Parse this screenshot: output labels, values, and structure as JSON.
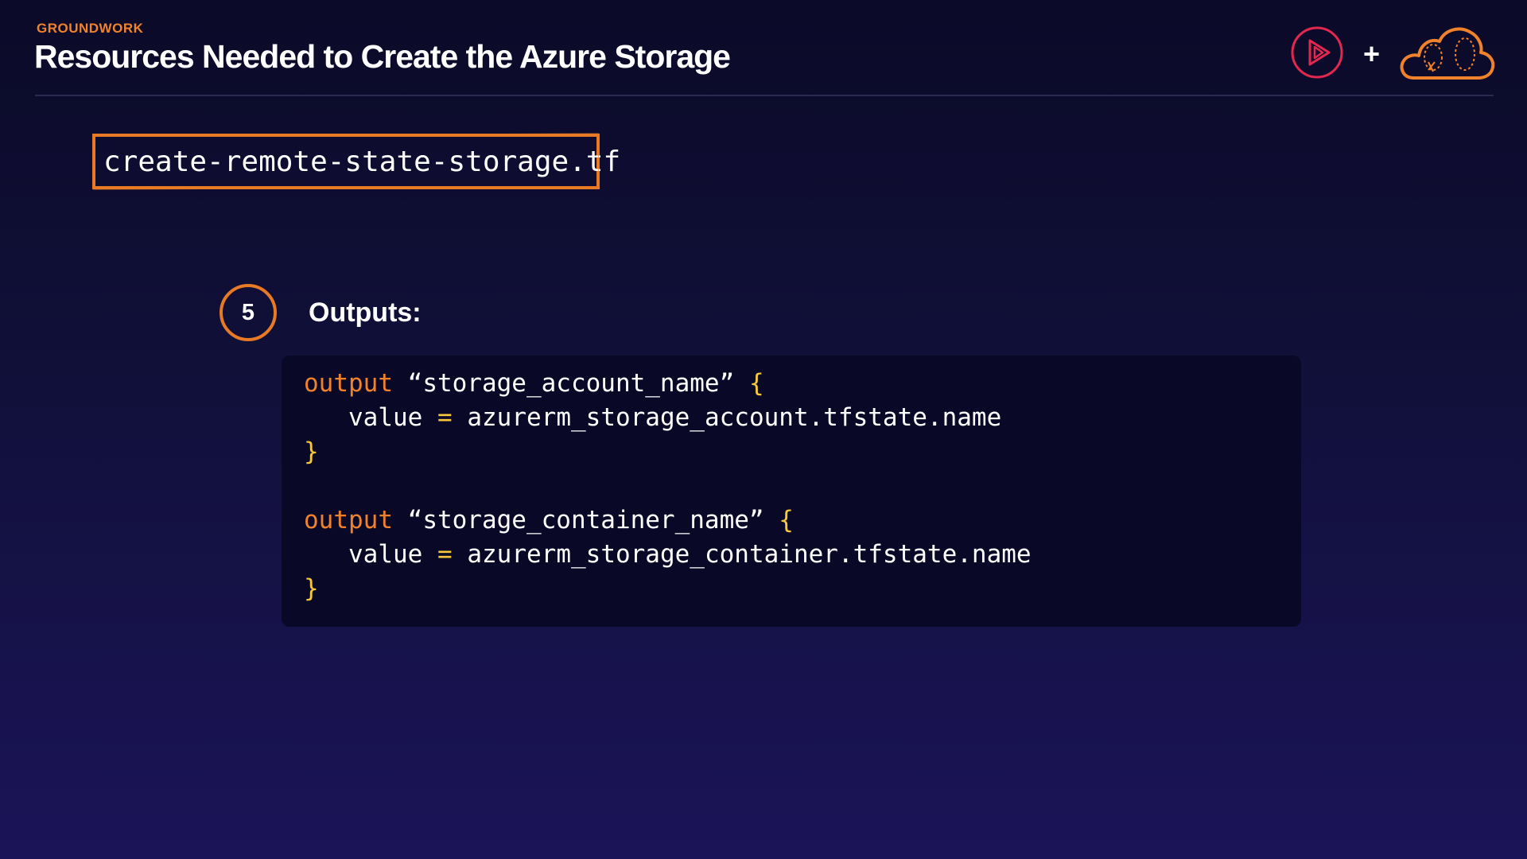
{
  "header": {
    "eyebrow": "GROUNDWORK",
    "title": "Resources Needed to Create the Azure Storage",
    "plus": "+"
  },
  "icons": {
    "play_logo": "play-circle-icon",
    "cloud_logo": "cloud-icon"
  },
  "filename": "create-remote-state-storage.tf",
  "step": {
    "number": "5",
    "label": "Outputs:"
  },
  "code": {
    "blocks": [
      {
        "keyword": "output",
        "name": "“storage_account_name”",
        "open_brace": "{",
        "attr": "value",
        "op": "=",
        "expr": "azurerm_storage_account.tfstate.name",
        "close_brace": "}"
      },
      {
        "keyword": "output",
        "name": "“storage_container_name”",
        "open_brace": "{",
        "attr": "value",
        "op": "=",
        "expr": "azurerm_storage_container.tfstate.name",
        "close_brace": "}"
      }
    ]
  },
  "colors": {
    "accent_orange": "#e87a25",
    "brace_yellow": "#f7c93a",
    "code_bg": "#090827",
    "play_logo": "#e3284f"
  }
}
